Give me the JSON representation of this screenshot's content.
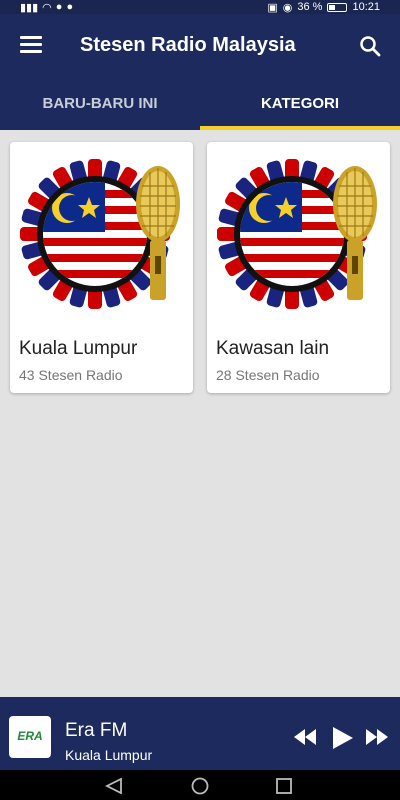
{
  "status_bar": {
    "battery_percent": "36 %",
    "time": "10:21"
  },
  "app_bar": {
    "title": "Stesen Radio Malaysia"
  },
  "tabs": [
    {
      "label": "BARU-BARU INI",
      "active": false
    },
    {
      "label": "KATEGORI",
      "active": true
    }
  ],
  "categories": [
    {
      "name": "Kuala Lumpur",
      "count": "43 Stesen Radio"
    },
    {
      "name": "Kawasan lain",
      "count": "28 Stesen Radio"
    }
  ],
  "player": {
    "logo_text": "ERA",
    "station": "Era FM",
    "city": "Kuala Lumpur"
  },
  "colors": {
    "primary": "#1c2a5e",
    "accent": "#f5d02b",
    "background": "#e2e2e2"
  }
}
